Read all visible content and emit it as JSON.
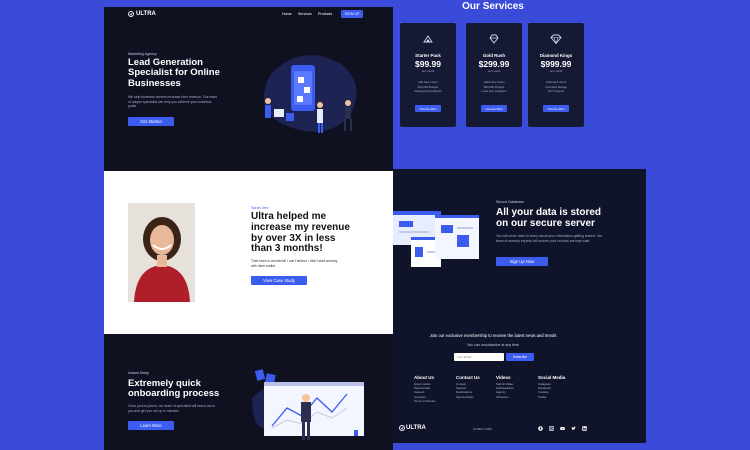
{
  "hero": {
    "brand": "ULTRA",
    "nav": [
      "Home",
      "Services",
      "Products"
    ],
    "signup": "SIGN UP",
    "eyebrow": "Marketing Agency",
    "title": "Lead Generation Specialist for Online Businesses",
    "text": "We help business owners increase their revenue. Our team of unique specialist can help you achieve your business goals.",
    "cta": "Get Started"
  },
  "services": {
    "title": "Our Services",
    "plans": [
      {
        "name": "Starter Pack",
        "price": "$99.99",
        "per": "per month",
        "features": [
          "100 New Users",
          "$10,000 Budget",
          "Retargeting analytics"
        ],
        "cta": "Choose Plan"
      },
      {
        "name": "Gold Rush",
        "price": "$299.99",
        "per": "per month",
        "features": [
          "1000 New Users",
          "$50,000 Budget",
          "Lead Gen Analytics"
        ],
        "cta": "Choose Plan"
      },
      {
        "name": "Diamond Kings",
        "price": "$999.99",
        "per": "per month",
        "features": [
          "Unlimited Users",
          "Unlimited Budget",
          "24/7 Support"
        ],
        "cta": "Choose Plan"
      }
    ]
  },
  "testimonial": {
    "author": "Sarah Jent",
    "quote": "Ultra helped me increase my revenue by over 3X in less than 3 months!",
    "text": "Their team is wonderful! I can't believe I didn't start working with them earlier.",
    "cta": "View Case Study"
  },
  "secure": {
    "eyebrow": "Secure Database",
    "title": "All your data is stored on our secure server",
    "text": "You will never have to worry about your information getting leaked. Our team of security experts will ensure your records are kept safe.",
    "cta": "Sign Up Now"
  },
  "onboarding": {
    "eyebrow": "Instant Setup",
    "title": "Extremely quick onboarding process",
    "text": "Once you've joined, our team of specialist will reach out to you and get you set up in minutes.",
    "cta": "Learn More"
  },
  "newsletter": {
    "title": "Join our exclusive membership to receive the latest news and trends",
    "subtitle": "You can unsubscribe at any time",
    "placeholder": "Your Email",
    "cta": "Subscribe"
  },
  "footer": {
    "columns": [
      {
        "title": "About Us",
        "links": [
          "How it works",
          "Testimonials",
          "Careers",
          "Investors",
          "Terms of Service"
        ]
      },
      {
        "title": "Contact Us",
        "links": [
          "Contact",
          "Support",
          "Destinations",
          "Sponsorships"
        ]
      },
      {
        "title": "Videos",
        "links": [
          "Submit Video",
          "Ambassadors",
          "Agency",
          "Influencer"
        ]
      },
      {
        "title": "Social Media",
        "links": [
          "Instagram",
          "Facebook",
          "Youtube",
          "Twitter"
        ]
      }
    ],
    "brand": "ULTRA",
    "copyright": "ULTRA © 2020",
    "social_icons": [
      "facebook-icon",
      "instagram-icon",
      "youtube-icon",
      "twitter-icon",
      "linkedin-icon"
    ]
  },
  "colors": {
    "accent": "#3c5cf0",
    "dark": "#0f1121",
    "background": "#3a4ad9"
  }
}
